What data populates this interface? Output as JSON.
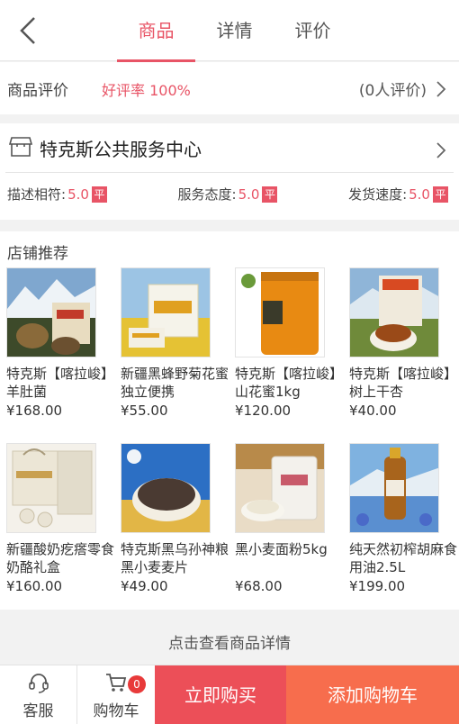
{
  "nav": {
    "tabs": [
      {
        "label": "商品",
        "active": true
      },
      {
        "label": "详情",
        "active": false
      },
      {
        "label": "评价",
        "active": false
      }
    ]
  },
  "review": {
    "label": "商品评价",
    "rate": "好评率 100%",
    "count": "(0人评价)"
  },
  "shop": {
    "name": "特克斯公共服务中心",
    "scores": [
      {
        "label": "描述相符:",
        "value": "5.0",
        "tag": "平"
      },
      {
        "label": "服务态度:",
        "value": "5.0",
        "tag": "平"
      },
      {
        "label": "发货速度:",
        "value": "5.0",
        "tag": "平"
      }
    ]
  },
  "recommend": {
    "title": "店铺推荐",
    "items": [
      {
        "name": "特克斯【喀拉峻】羊肚菌",
        "price": "¥168.00"
      },
      {
        "name": "新疆黑蜂野菊花蜜 独立便携",
        "price": "¥55.00"
      },
      {
        "name": "特克斯【喀拉峻】山花蜜1kg",
        "price": "¥120.00"
      },
      {
        "name": "特克斯【喀拉峻】树上干杏",
        "price": "¥40.00"
      },
      {
        "name": "新疆酸奶疙瘩零食奶酪礼盒",
        "price": "¥160.00"
      },
      {
        "name": "特克斯黑乌孙神粮黑小麦麦片",
        "price": "¥49.00"
      },
      {
        "name": "黑小麦面粉5kg",
        "price": "¥68.00"
      },
      {
        "name": "纯天然初榨胡麻食用油2.5L",
        "price": "¥199.00"
      }
    ]
  },
  "details_link": "点击查看商品详情",
  "bottom": {
    "service": "客服",
    "cart": "购物车",
    "cart_count": "0",
    "buy_now": "立即购买",
    "add_cart": "添加购物车"
  },
  "colors": {
    "accent": "#e85466",
    "buy": "#ec4f58",
    "add_cart": "#f76d4d"
  }
}
